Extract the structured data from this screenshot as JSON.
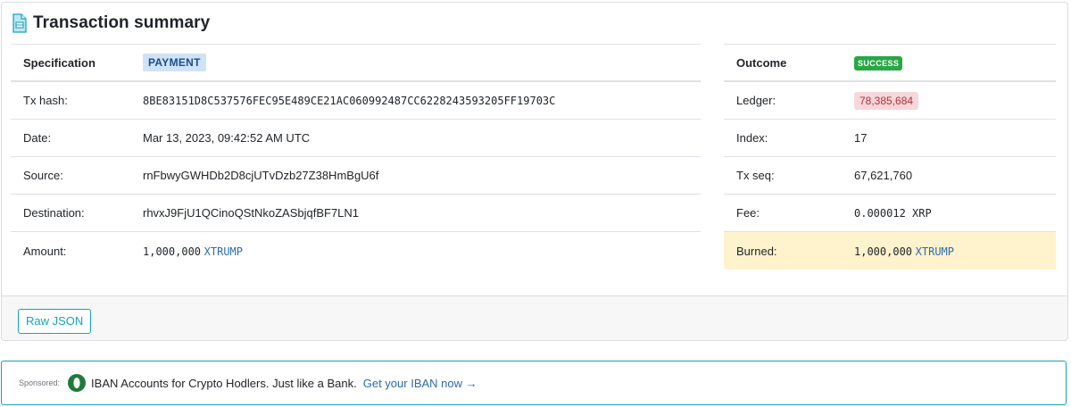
{
  "colors": {
    "accent": "#17a2b8",
    "link": "#2a6bb0",
    "success": "#28a745",
    "payment_badge_bg": "#cfe2f7",
    "ledger_badge_bg": "#f8d7da",
    "highlight_bg": "#fff3cd"
  },
  "card": {
    "icon": "document-icon",
    "title": "Transaction summary"
  },
  "left": {
    "head": {
      "label": "Specification",
      "badge": "PAYMENT"
    },
    "rows": [
      {
        "label": "Tx hash:",
        "value": "8BE83151D8C537576FEC95E489CE21AC060992487CC6228243593205FF19703C"
      },
      {
        "label": "Date:",
        "value": "Mar 13, 2023, 09:42:52 AM UTC"
      },
      {
        "label": "Source:",
        "value": "rnFbwyGWHDb2D8cjUTvDzb27Z38HmBgU6f"
      },
      {
        "label": "Destination:",
        "value": "rhvxJ9FjU1QCinoQStNkoZASbjqfBF7LN1"
      },
      {
        "label": "Amount:",
        "amount": "1,000,000",
        "currency": "XTRUMP"
      }
    ]
  },
  "right": {
    "head": {
      "label": "Outcome",
      "badge": "SUCCESS"
    },
    "rows": [
      {
        "label": "Ledger:",
        "value": "78,385,684"
      },
      {
        "label": "Index:",
        "value": "17"
      },
      {
        "label": "Tx seq:",
        "value": "67,621,760"
      },
      {
        "label": "Fee:",
        "value": "0.000012 XRP"
      },
      {
        "label": "Burned:",
        "amount": "1,000,000",
        "currency": "XTRUMP"
      }
    ]
  },
  "footer": {
    "raw_json_label": "Raw JSON"
  },
  "sponsor": {
    "label": "Sponsored:",
    "logo": "iban-logo-icon",
    "text": "IBAN Accounts for Crypto Hodlers. Just like a Bank.",
    "link": "Get your IBAN now →"
  }
}
